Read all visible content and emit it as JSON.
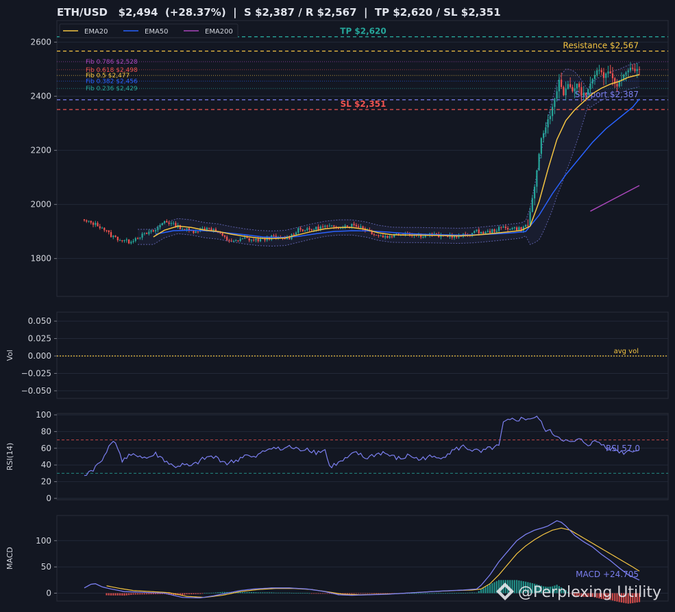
{
  "title": "ETH/USD   $2,494  (+28.37%)  |  S $2,387 / R $2,567  |  TP $2,620 / SL $2,351",
  "colors": {
    "background": "#131722",
    "panel": "#131722",
    "grid": "#232838",
    "up": "#26a69a",
    "down": "#ef5350",
    "ema20": "#f5c542",
    "ema50": "#2962ff",
    "ema200": "#ab47bc",
    "tp": "#26a69a",
    "sl": "#ef5350",
    "resistance": "#f5c542",
    "support": "#7b7ff0",
    "rsi": "#7b7ff0",
    "macd": "#7b7ff0",
    "signal": "#f5c542"
  },
  "watermark": "@Perplexing Utility",
  "chart_data": [
    {
      "type": "candlestick",
      "panel": "price",
      "ylim": [
        1660,
        2680
      ],
      "yticks": [
        1800,
        2000,
        2200,
        2400,
        2600
      ],
      "legend": {
        "placement": "top-left",
        "entries": [
          "EMA20",
          "EMA50",
          "EMA200"
        ]
      },
      "levels": [
        {
          "label": "TP $2,620",
          "value": 2620,
          "style": "tp"
        },
        {
          "label": "Resistance $2,567",
          "value": 2567,
          "style": "resistance"
        },
        {
          "label": "Support $2,387",
          "value": 2387,
          "style": "support"
        },
        {
          "label": "SL $2,351",
          "value": 2351,
          "style": "sl"
        }
      ],
      "fib_levels": [
        {
          "label": "Fib 0.786 $2,528",
          "value": 2528,
          "color": "#ab47bc"
        },
        {
          "label": "Fib 0.618 $2,498",
          "value": 2498,
          "color": "#ef5350"
        },
        {
          "label": "Fib 0.5 $2,477",
          "value": 2477,
          "color": "#f5c542"
        },
        {
          "label": "Fib 0.382 $2,456",
          "value": 2456,
          "color": "#2962ff"
        },
        {
          "label": "Fib 0.236 $2,429",
          "value": 2429,
          "color": "#26a69a"
        }
      ],
      "close_anchors": [
        [
          0,
          1938
        ],
        [
          4,
          1930
        ],
        [
          8,
          1915
        ],
        [
          12,
          1885
        ],
        [
          16,
          1870
        ],
        [
          20,
          1862
        ],
        [
          24,
          1880
        ],
        [
          28,
          1892
        ],
        [
          32,
          1905
        ],
        [
          36,
          1940
        ],
        [
          40,
          1925
        ],
        [
          44,
          1912
        ],
        [
          48,
          1900
        ],
        [
          52,
          1908
        ],
        [
          56,
          1915
        ],
        [
          60,
          1895
        ],
        [
          64,
          1870
        ],
        [
          68,
          1862
        ],
        [
          72,
          1875
        ],
        [
          76,
          1868
        ],
        [
          80,
          1870
        ],
        [
          84,
          1880
        ],
        [
          88,
          1872
        ],
        [
          92,
          1878
        ],
        [
          96,
          1910
        ],
        [
          100,
          1905
        ],
        [
          104,
          1912
        ],
        [
          108,
          1918
        ],
        [
          112,
          1915
        ],
        [
          116,
          1920
        ],
        [
          120,
          1925
        ],
        [
          124,
          1918
        ],
        [
          128,
          1900
        ],
        [
          132,
          1885
        ],
        [
          136,
          1880
        ],
        [
          140,
          1890
        ],
        [
          144,
          1895
        ],
        [
          148,
          1888
        ],
        [
          152,
          1885
        ],
        [
          156,
          1890
        ],
        [
          160,
          1882
        ],
        [
          164,
          1885
        ],
        [
          168,
          1880
        ],
        [
          172,
          1890
        ],
        [
          176,
          1900
        ],
        [
          180,
          1895
        ],
        [
          184,
          1905
        ],
        [
          188,
          1915
        ],
        [
          192,
          1912
        ],
        [
          196,
          1910
        ],
        [
          199,
          1925
        ],
        [
          201,
          2020
        ],
        [
          203,
          2120
        ],
        [
          205,
          2240
        ],
        [
          207,
          2290
        ],
        [
          209,
          2330
        ],
        [
          211,
          2390
        ],
        [
          213,
          2460
        ],
        [
          215,
          2410
        ],
        [
          217,
          2440
        ],
        [
          219,
          2420
        ],
        [
          221,
          2445
        ],
        [
          223,
          2410
        ],
        [
          225,
          2400
        ],
        [
          227,
          2450
        ],
        [
          229,
          2480
        ],
        [
          231,
          2500
        ],
        [
          233,
          2470
        ],
        [
          235,
          2495
        ],
        [
          237,
          2460
        ],
        [
          239,
          2440
        ],
        [
          241,
          2470
        ],
        [
          243,
          2490
        ],
        [
          245,
          2510
        ],
        [
          247,
          2500
        ],
        [
          249,
          2495
        ]
      ],
      "ema20_points": [
        [
          31,
          1880
        ],
        [
          36,
          1905
        ],
        [
          42,
          1920
        ],
        [
          48,
          1915
        ],
        [
          54,
          1905
        ],
        [
          60,
          1900
        ],
        [
          66,
          1890
        ],
        [
          72,
          1882
        ],
        [
          78,
          1876
        ],
        [
          84,
          1874
        ],
        [
          90,
          1876
        ],
        [
          96,
          1888
        ],
        [
          102,
          1900
        ],
        [
          108,
          1910
        ],
        [
          114,
          1915
        ],
        [
          120,
          1915
        ],
        [
          126,
          1908
        ],
        [
          132,
          1895
        ],
        [
          138,
          1888
        ],
        [
          144,
          1887
        ],
        [
          150,
          1887
        ],
        [
          156,
          1886
        ],
        [
          162,
          1885
        ],
        [
          168,
          1884
        ],
        [
          174,
          1886
        ],
        [
          180,
          1890
        ],
        [
          186,
          1895
        ],
        [
          192,
          1900
        ],
        [
          196,
          1904
        ],
        [
          200,
          1920
        ],
        [
          204,
          2010
        ],
        [
          208,
          2130
        ],
        [
          212,
          2240
        ],
        [
          216,
          2310
        ],
        [
          220,
          2350
        ],
        [
          224,
          2380
        ],
        [
          228,
          2410
        ],
        [
          232,
          2430
        ],
        [
          236,
          2445
        ],
        [
          240,
          2455
        ],
        [
          244,
          2470
        ],
        [
          249,
          2480
        ]
      ],
      "ema50_points": [
        [
          32,
          1890
        ],
        [
          40,
          1903
        ],
        [
          48,
          1905
        ],
        [
          56,
          1902
        ],
        [
          64,
          1895
        ],
        [
          72,
          1888
        ],
        [
          80,
          1880
        ],
        [
          88,
          1878
        ],
        [
          96,
          1882
        ],
        [
          104,
          1892
        ],
        [
          112,
          1900
        ],
        [
          120,
          1903
        ],
        [
          128,
          1902
        ],
        [
          136,
          1898
        ],
        [
          144,
          1893
        ],
        [
          152,
          1890
        ],
        [
          160,
          1888
        ],
        [
          168,
          1887
        ],
        [
          176,
          1888
        ],
        [
          184,
          1891
        ],
        [
          192,
          1895
        ],
        [
          198,
          1900
        ],
        [
          204,
          1960
        ],
        [
          210,
          2040
        ],
        [
          216,
          2110
        ],
        [
          222,
          2170
        ],
        [
          228,
          2230
        ],
        [
          234,
          2280
        ],
        [
          240,
          2320
        ],
        [
          246,
          2360
        ],
        [
          249,
          2390
        ]
      ],
      "ema200_points": [
        [
          227,
          1975
        ],
        [
          249,
          2070
        ]
      ]
    },
    {
      "type": "bar",
      "panel": "volume",
      "ylabel": "Vol",
      "ylim": [
        -0.055,
        0.055
      ],
      "yticks": [
        0.05,
        0.025,
        0.0,
        -0.025,
        -0.05
      ],
      "yticklabels": [
        "0.050",
        "0.025",
        "0.000",
        "−0.025",
        "−0.050"
      ],
      "avg_line": {
        "label": "avg vol",
        "value": 0.0
      }
    },
    {
      "type": "line",
      "panel": "rsi",
      "ylabel": "RSI(14)",
      "ylim": [
        0,
        100
      ],
      "yticks": [
        0,
        20,
        40,
        60,
        80,
        100
      ],
      "overbought": 70,
      "oversold": 30,
      "last_label": "RSI 57.0",
      "anchors": [
        [
          0,
          28
        ],
        [
          4,
          35
        ],
        [
          8,
          45
        ],
        [
          10,
          58
        ],
        [
          12,
          68
        ],
        [
          15,
          62
        ],
        [
          17,
          45
        ],
        [
          20,
          50
        ],
        [
          24,
          52
        ],
        [
          28,
          48
        ],
        [
          32,
          53
        ],
        [
          36,
          46
        ],
        [
          40,
          38
        ],
        [
          44,
          40
        ],
        [
          48,
          38
        ],
        [
          52,
          45
        ],
        [
          56,
          50
        ],
        [
          60,
          48
        ],
        [
          64,
          42
        ],
        [
          68,
          45
        ],
        [
          72,
          52
        ],
        [
          76,
          48
        ],
        [
          80,
          55
        ],
        [
          84,
          62
        ],
        [
          88,
          58
        ],
        [
          92,
          62
        ],
        [
          96,
          58
        ],
        [
          100,
          60
        ],
        [
          104,
          55
        ],
        [
          108,
          58
        ],
        [
          110,
          38
        ],
        [
          114,
          42
        ],
        [
          118,
          48
        ],
        [
          122,
          55
        ],
        [
          126,
          48
        ],
        [
          130,
          52
        ],
        [
          134,
          55
        ],
        [
          138,
          50
        ],
        [
          142,
          47
        ],
        [
          146,
          52
        ],
        [
          150,
          46
        ],
        [
          154,
          50
        ],
        [
          158,
          48
        ],
        [
          162,
          52
        ],
        [
          166,
          58
        ],
        [
          170,
          62
        ],
        [
          174,
          58
        ],
        [
          178,
          55
        ],
        [
          182,
          60
        ],
        [
          186,
          62
        ],
        [
          188,
          90
        ],
        [
          192,
          94
        ],
        [
          196,
          95
        ],
        [
          200,
          96
        ],
        [
          204,
          96
        ],
        [
          206,
          84
        ],
        [
          210,
          78
        ],
        [
          214,
          72
        ],
        [
          218,
          66
        ],
        [
          222,
          70
        ],
        [
          226,
          65
        ],
        [
          230,
          68
        ],
        [
          234,
          62
        ],
        [
          238,
          58
        ],
        [
          242,
          55
        ],
        [
          245,
          58
        ],
        [
          249,
          57
        ]
      ]
    },
    {
      "type": "line",
      "panel": "macd",
      "ylabel": "MACD",
      "ylim": [
        -15,
        148
      ],
      "yticks": [
        0,
        50,
        100
      ],
      "last_label": "MACD +24.705",
      "macd_anchors": [
        [
          0,
          10
        ],
        [
          3,
          17
        ],
        [
          5,
          18
        ],
        [
          8,
          12
        ],
        [
          12,
          8
        ],
        [
          18,
          3
        ],
        [
          24,
          2
        ],
        [
          30,
          1
        ],
        [
          36,
          0
        ],
        [
          44,
          -8
        ],
        [
          52,
          -9
        ],
        [
          58,
          -5
        ],
        [
          64,
          0
        ],
        [
          70,
          5
        ],
        [
          76,
          8
        ],
        [
          84,
          10
        ],
        [
          92,
          10
        ],
        [
          100,
          8
        ],
        [
          108,
          3
        ],
        [
          114,
          -3
        ],
        [
          120,
          -4
        ],
        [
          128,
          -3
        ],
        [
          136,
          -2
        ],
        [
          144,
          0
        ],
        [
          152,
          2
        ],
        [
          160,
          4
        ],
        [
          170,
          6
        ],
        [
          176,
          8
        ],
        [
          178,
          15
        ],
        [
          182,
          35
        ],
        [
          186,
          60
        ],
        [
          190,
          80
        ],
        [
          194,
          100
        ],
        [
          198,
          112
        ],
        [
          202,
          120
        ],
        [
          206,
          125
        ],
        [
          208,
          128
        ],
        [
          210,
          133
        ],
        [
          212,
          138
        ],
        [
          214,
          135
        ],
        [
          216,
          128
        ],
        [
          220,
          110
        ],
        [
          224,
          98
        ],
        [
          228,
          88
        ],
        [
          232,
          74
        ],
        [
          236,
          62
        ],
        [
          240,
          48
        ],
        [
          244,
          35
        ],
        [
          249,
          25
        ]
      ],
      "signal_anchors": [
        [
          10,
          14
        ],
        [
          16,
          9
        ],
        [
          22,
          5
        ],
        [
          30,
          3
        ],
        [
          38,
          1
        ],
        [
          46,
          -6
        ],
        [
          54,
          -8
        ],
        [
          62,
          -4
        ],
        [
          70,
          3
        ],
        [
          78,
          7
        ],
        [
          86,
          9
        ],
        [
          94,
          9
        ],
        [
          102,
          7
        ],
        [
          110,
          2
        ],
        [
          116,
          -2
        ],
        [
          124,
          -3
        ],
        [
          132,
          -2
        ],
        [
          140,
          -1
        ],
        [
          148,
          1
        ],
        [
          156,
          3
        ],
        [
          166,
          5
        ],
        [
          174,
          6
        ],
        [
          178,
          8
        ],
        [
          182,
          18
        ],
        [
          186,
          35
        ],
        [
          190,
          55
        ],
        [
          194,
          75
        ],
        [
          198,
          90
        ],
        [
          202,
          102
        ],
        [
          206,
          112
        ],
        [
          210,
          120
        ],
        [
          214,
          124
        ],
        [
          218,
          120
        ],
        [
          222,
          110
        ],
        [
          226,
          100
        ],
        [
          230,
          90
        ],
        [
          234,
          80
        ],
        [
          238,
          70
        ],
        [
          242,
          60
        ],
        [
          246,
          50
        ],
        [
          249,
          42
        ]
      ]
    }
  ]
}
